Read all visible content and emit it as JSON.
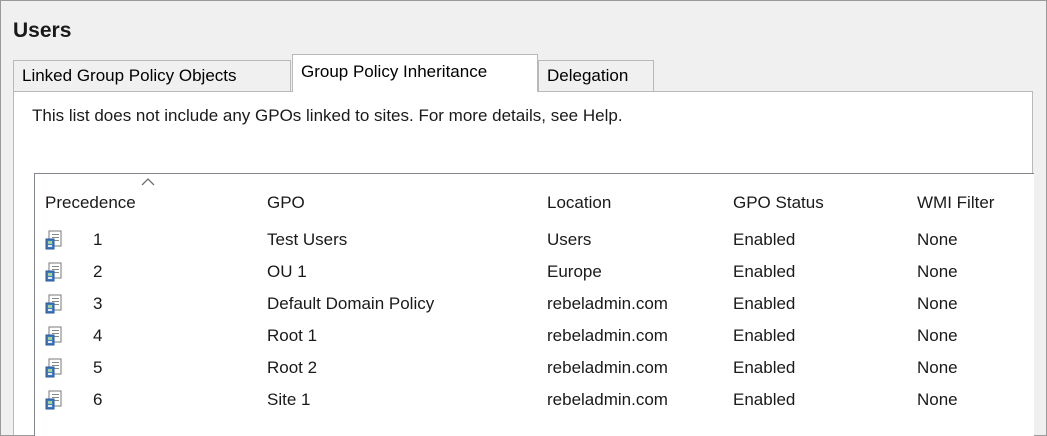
{
  "window": {
    "title": "Users"
  },
  "tabs": [
    {
      "label": "Linked Group Policy Objects"
    },
    {
      "label": "Group Policy Inheritance",
      "active": true
    },
    {
      "label": "Delegation"
    }
  ],
  "info_text": "This list does not include any GPOs linked to sites. For more details, see Help.",
  "table": {
    "columns": [
      "Precedence",
      "GPO",
      "Location",
      "GPO Status",
      "WMI Filter"
    ],
    "sorted_by": "Precedence",
    "rows": [
      {
        "precedence": "1",
        "gpo": "Test Users",
        "location": "Users",
        "status": "Enabled",
        "wmi": "None",
        "icon": "gpo-icon"
      },
      {
        "precedence": "2",
        "gpo": "OU 1",
        "location": "Europe",
        "status": "Enabled",
        "wmi": "None",
        "icon": "gpo-icon"
      },
      {
        "precedence": "3",
        "gpo": "Default Domain Policy",
        "location": "rebeladmin.com",
        "status": "Enabled",
        "wmi": "None",
        "icon": "gpo-icon"
      },
      {
        "precedence": "4",
        "gpo": "Root 1",
        "location": "rebeladmin.com",
        "status": "Enabled",
        "wmi": "None",
        "icon": "gpo-icon"
      },
      {
        "precedence": "5",
        "gpo": "Root 2",
        "location": "rebeladmin.com",
        "status": "Enabled",
        "wmi": "None",
        "icon": "gpo-icon"
      },
      {
        "precedence": "6",
        "gpo": "Site 1",
        "location": "rebeladmin.com",
        "status": "Enabled",
        "wmi": "None",
        "icon": "gpo-icon"
      }
    ]
  }
}
